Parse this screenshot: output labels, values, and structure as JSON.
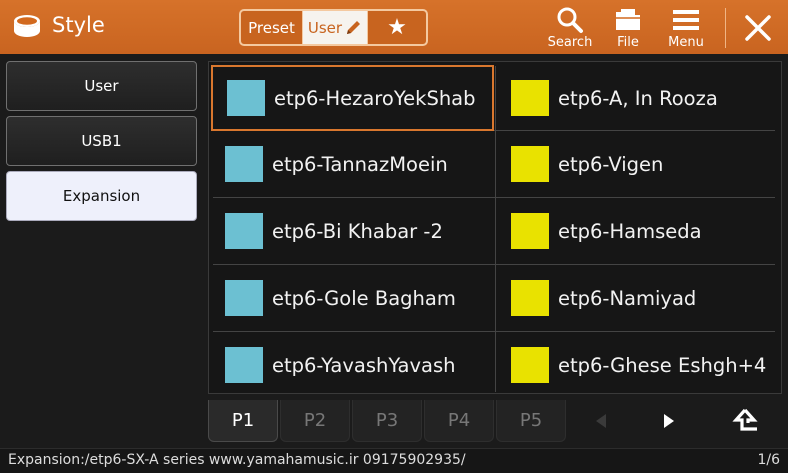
{
  "header": {
    "title": "Style",
    "tabs": {
      "preset": "Preset",
      "user": "User",
      "favorite": "★"
    },
    "tools": {
      "search": "Search",
      "file": "File",
      "menu": "Menu"
    }
  },
  "sidebar": {
    "items": [
      {
        "label": "User"
      },
      {
        "label": "USB1"
      },
      {
        "label": "Expansion"
      }
    ]
  },
  "styles": {
    "left": [
      {
        "name": "etp6-HezaroYekShab"
      },
      {
        "name": "etp6-TannazMoein"
      },
      {
        "name": "etp6-Bi Khabar -2"
      },
      {
        "name": "etp6-Gole Bagham"
      },
      {
        "name": "etp6-YavashYavash"
      }
    ],
    "right": [
      {
        "name": "etp6-A, In Rooza"
      },
      {
        "name": "etp6-Vigen"
      },
      {
        "name": "etp6-Hamseda"
      },
      {
        "name": "etp6-Namiyad"
      },
      {
        "name": "etp6-Ghese Eshgh+4"
      }
    ]
  },
  "colors": {
    "accent": "#c8641f",
    "swatch_blue": "#6cc0d2",
    "swatch_yellow": "#e9e200",
    "selected_border": "#d9772e"
  },
  "pager": {
    "pages": [
      "P1",
      "P2",
      "P3",
      "P4",
      "P5"
    ]
  },
  "status": {
    "path": "Expansion:/etp6-SX-A series  www.yamahamusic.ir 09175902935/",
    "page": "1/6"
  }
}
